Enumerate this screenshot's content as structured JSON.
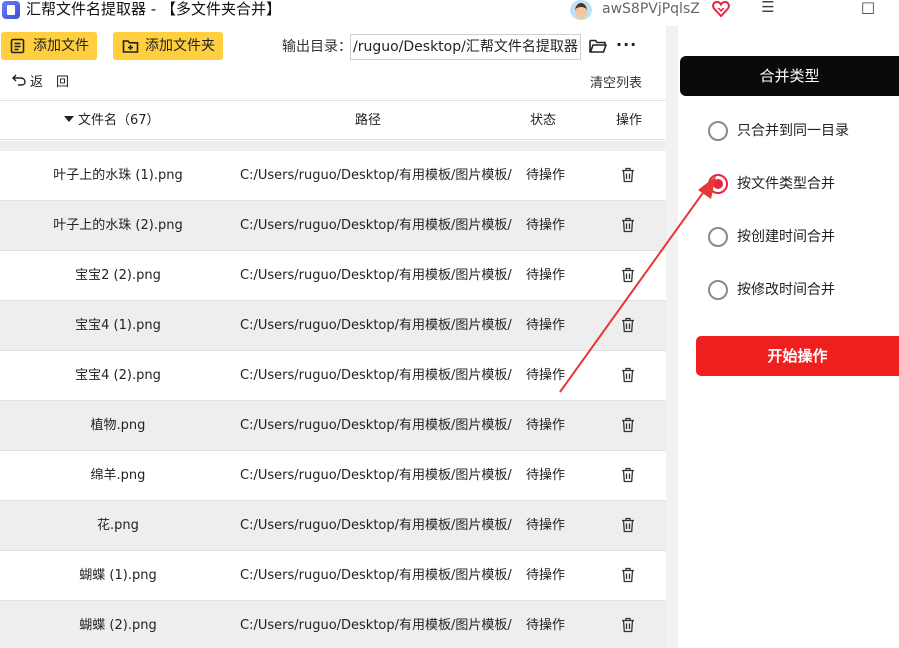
{
  "window": {
    "title": "汇帮文件名提取器 - 【多文件夹合并】",
    "user_name": "awS8PVjPqlsZ",
    "minimize_glyph": "☰",
    "maximize_glyph": "□"
  },
  "toolbar": {
    "add_file_label": "添加文件",
    "add_folder_label": "添加文件夹",
    "output_label": "输出目录：",
    "output_path": "/ruguo/Desktop/汇帮文件名提取器",
    "more_glyph": "···"
  },
  "nav": {
    "back_label": "返　回",
    "clear_label": "清空列表"
  },
  "table": {
    "headers": {
      "name": "文件名（67）",
      "path": "路径",
      "status": "状态",
      "action": "操作"
    },
    "rows": [
      {
        "name": "叶子上的水珠 (1).png",
        "path": "C:/Users/ruguo/Desktop/有用模板/图片模板/",
        "status": "待操作"
      },
      {
        "name": "叶子上的水珠 (2).png",
        "path": "C:/Users/ruguo/Desktop/有用模板/图片模板/",
        "status": "待操作"
      },
      {
        "name": "宝宝2 (2).png",
        "path": "C:/Users/ruguo/Desktop/有用模板/图片模板/",
        "status": "待操作"
      },
      {
        "name": "宝宝4 (1).png",
        "path": "C:/Users/ruguo/Desktop/有用模板/图片模板/",
        "status": "待操作"
      },
      {
        "name": "宝宝4 (2).png",
        "path": "C:/Users/ruguo/Desktop/有用模板/图片模板/",
        "status": "待操作"
      },
      {
        "name": "植物.png",
        "path": "C:/Users/ruguo/Desktop/有用模板/图片模板/",
        "status": "待操作"
      },
      {
        "name": "绵羊.png",
        "path": "C:/Users/ruguo/Desktop/有用模板/图片模板/",
        "status": "待操作"
      },
      {
        "name": "花.png",
        "path": "C:/Users/ruguo/Desktop/有用模板/图片模板/",
        "status": "待操作"
      },
      {
        "name": "蝴蝶 (1).png",
        "path": "C:/Users/ruguo/Desktop/有用模板/图片模板/",
        "status": "待操作"
      },
      {
        "name": "蝴蝶 (2).png",
        "path": "C:/Users/ruguo/Desktop/有用模板/图片模板/",
        "status": "待操作"
      }
    ]
  },
  "side_panel": {
    "title": "合并类型",
    "options": [
      {
        "label": "只合并到同一目录",
        "checked": false
      },
      {
        "label": "按文件类型合并",
        "checked": true
      },
      {
        "label": "按创建时间合并",
        "checked": false
      },
      {
        "label": "按修改时间合并",
        "checked": false
      }
    ],
    "start_label": "开始操作"
  },
  "colors": {
    "accent_yellow": "#ffcf3f",
    "start_red": "#ef1f1f",
    "radio_red": "#e5263f",
    "annotation_arrow": "#e53935"
  }
}
